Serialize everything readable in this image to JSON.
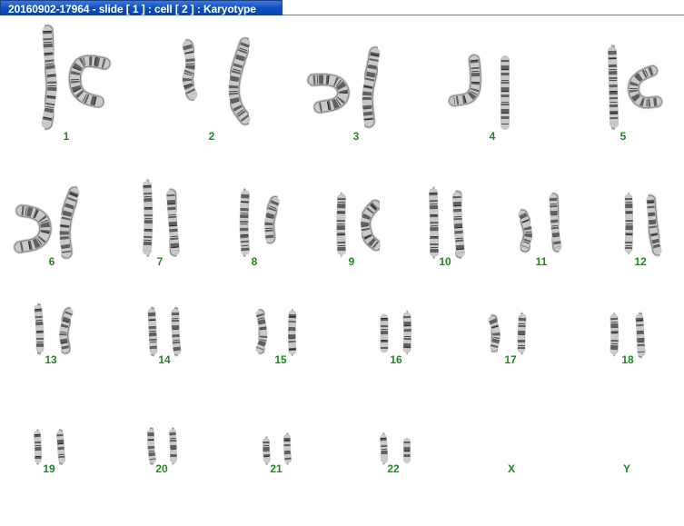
{
  "window": {
    "title": "20160902-17964 - slide [ 1 ] : cell [ 2 ] : Karyotype"
  },
  "colors": {
    "titlebar": "#0a4fc0",
    "label": "#1e8a1e",
    "background": "#ffffff"
  },
  "chromosomes": [
    {
      "label": "1"
    },
    {
      "label": "2"
    },
    {
      "label": "3"
    },
    {
      "label": "4"
    },
    {
      "label": "5"
    },
    {
      "label": "6"
    },
    {
      "label": "7"
    },
    {
      "label": "8"
    },
    {
      "label": "9"
    },
    {
      "label": "10"
    },
    {
      "label": "11"
    },
    {
      "label": "12"
    },
    {
      "label": "13"
    },
    {
      "label": "14"
    },
    {
      "label": "15"
    },
    {
      "label": "16"
    },
    {
      "label": "17"
    },
    {
      "label": "18"
    },
    {
      "label": "19"
    },
    {
      "label": "20"
    },
    {
      "label": "21"
    },
    {
      "label": "22"
    },
    {
      "label": "X"
    },
    {
      "label": "Y"
    }
  ]
}
